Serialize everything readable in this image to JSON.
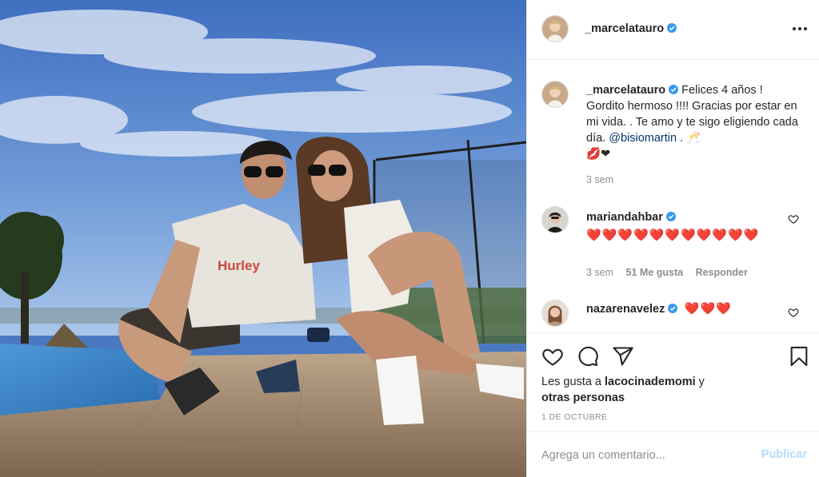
{
  "post": {
    "author": "_marcelatauro",
    "author_verified": true,
    "more_icon": "more-options-icon"
  },
  "caption": {
    "author": "_marcelatauro",
    "text_before_mention": "Felices 4 años ! Gordito hermoso !!!! Gracias por estar en mi vida. . Te amo y te sigo eligiendo cada día.",
    "mention": "@bisiomartin",
    "text_after_mention": ". 🥂",
    "emoji_line": "💋❤",
    "time": "3 sem"
  },
  "comments": [
    {
      "author": "mariandahbar",
      "verified": true,
      "text": "❤️❤️❤️❤️❤️❤️❤️❤️❤️❤️❤️",
      "time": "3 sem",
      "likes": "51 Me gusta",
      "reply_label": "Responder"
    },
    {
      "author": "nazarenavelez",
      "verified": true,
      "text": "❤️❤️❤️"
    }
  ],
  "actions": {
    "like_icon": "heart-icon",
    "comment_icon": "comment-icon",
    "share_icon": "share-icon",
    "save_icon": "bookmark-icon"
  },
  "likes": {
    "prefix": "Les gusta a",
    "user": "lacocinademomi",
    "conjunction": "y",
    "others": "otras personas"
  },
  "date": "1 DE OCTUBRE",
  "add_comment": {
    "placeholder": "Agrega un comentario...",
    "publish_label": "Publicar"
  },
  "photo": {
    "shirt_text": "Hurley"
  },
  "colors": {
    "link": "#00376b",
    "verified": "#3897f0",
    "publish_disabled": "#b3dbff",
    "muted": "#8e8e8e",
    "heart": "#ed4956"
  }
}
